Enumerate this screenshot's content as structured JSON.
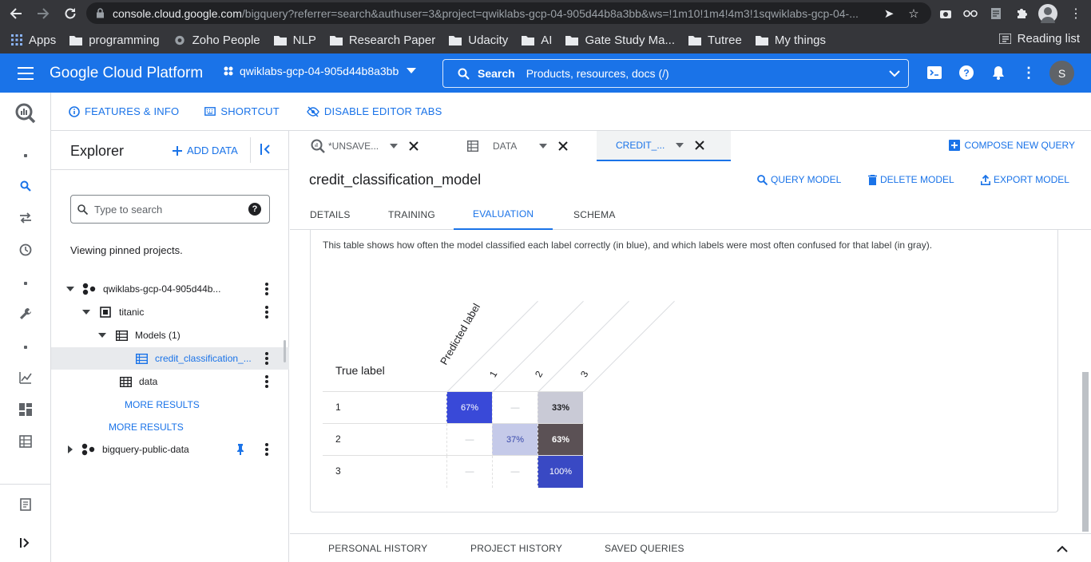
{
  "browser": {
    "url_host": "console.cloud.google.com",
    "url_path": "/bigquery?referrer=search&authuser=3&project=qwiklabs-gcp-04-905d44b8a3bb&ws=!1m10!1m4!4m3!1sqwiklabs-gcp-04-...",
    "bookmarks": [
      "Apps",
      "programming",
      "Zoho People",
      "NLP",
      "Research Paper",
      "Udacity",
      "AI",
      "Gate Study Ma...",
      "Tutree",
      "My things"
    ],
    "reading_list": "Reading list"
  },
  "header": {
    "brand": "Google Cloud Platform",
    "project": "qwiklabs-gcp-04-905d44b8a3bb",
    "search_label": "Search",
    "search_placeholder": "Products, resources, docs (/)",
    "avatar_letter": "S",
    "accent": "#1a73e8"
  },
  "featurebar": {
    "features": "FEATURES & INFO",
    "shortcut": "SHORTCUT",
    "disable_tabs": "DISABLE EDITOR TABS"
  },
  "explorer": {
    "title": "Explorer",
    "add_data": "ADD DATA",
    "search_placeholder": "Type to search",
    "pinned_note": "Viewing pinned projects.",
    "tree": {
      "project": "qwiklabs-gcp-04-905d44b...",
      "dataset": "titanic",
      "models": "Models (1)",
      "model": "credit_classification_...",
      "table": "data",
      "more1": "MORE RESULTS",
      "more2": "MORE RESULTS",
      "public": "bigquery-public-data"
    }
  },
  "tabs": {
    "query": "*UNSAVE...",
    "data": "DATA",
    "credit": "CREDIT_...",
    "compose": "COMPOSE NEW QUERY"
  },
  "model": {
    "title": "credit_classification_model",
    "query_model": "QUERY MODEL",
    "delete_model": "DELETE MODEL",
    "export_model": "EXPORT MODEL",
    "subtabs": [
      "DETAILS",
      "TRAINING",
      "EVALUATION",
      "SCHEMA"
    ]
  },
  "evaluation": {
    "description": "This table shows how often the model classified each label correctly (in blue), and which labels were most often confused for that label (in gray).",
    "true_label": "True label",
    "predicted_label": "Predicted label",
    "labels": [
      "1",
      "2",
      "3"
    ],
    "matrix": [
      [
        "67%",
        "—",
        "33%"
      ],
      [
        "—",
        "37%",
        "63%"
      ],
      [
        "—",
        "—",
        "100%"
      ]
    ]
  },
  "bottom": {
    "personal": "PERSONAL HISTORY",
    "project": "PROJECT HISTORY",
    "saved": "SAVED QUERIES"
  }
}
